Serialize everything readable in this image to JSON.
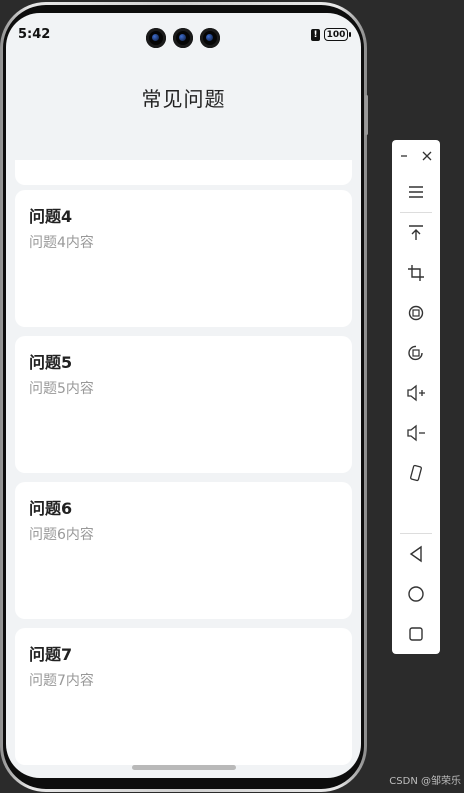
{
  "status_bar": {
    "time": "5:42",
    "battery": "100",
    "alert": "!"
  },
  "page": {
    "title": "常见问题"
  },
  "faq_items": [
    {
      "title": "问题4",
      "content": "问题4内容"
    },
    {
      "title": "问题5",
      "content": "问题5内容"
    },
    {
      "title": "问题6",
      "content": "问题6内容"
    },
    {
      "title": "问题7",
      "content": "问题7内容"
    }
  ],
  "emulator_toolbar": {
    "buttons": [
      "minimize-icon",
      "close-icon",
      "menu-icon",
      "pin-top-icon",
      "crop-icon",
      "rotate-left-icon",
      "rotate-right-icon",
      "volume-up-icon",
      "volume-down-icon",
      "shake-icon",
      "back-icon",
      "home-icon",
      "overview-icon"
    ]
  },
  "watermark": "CSDN @邹荣乐"
}
